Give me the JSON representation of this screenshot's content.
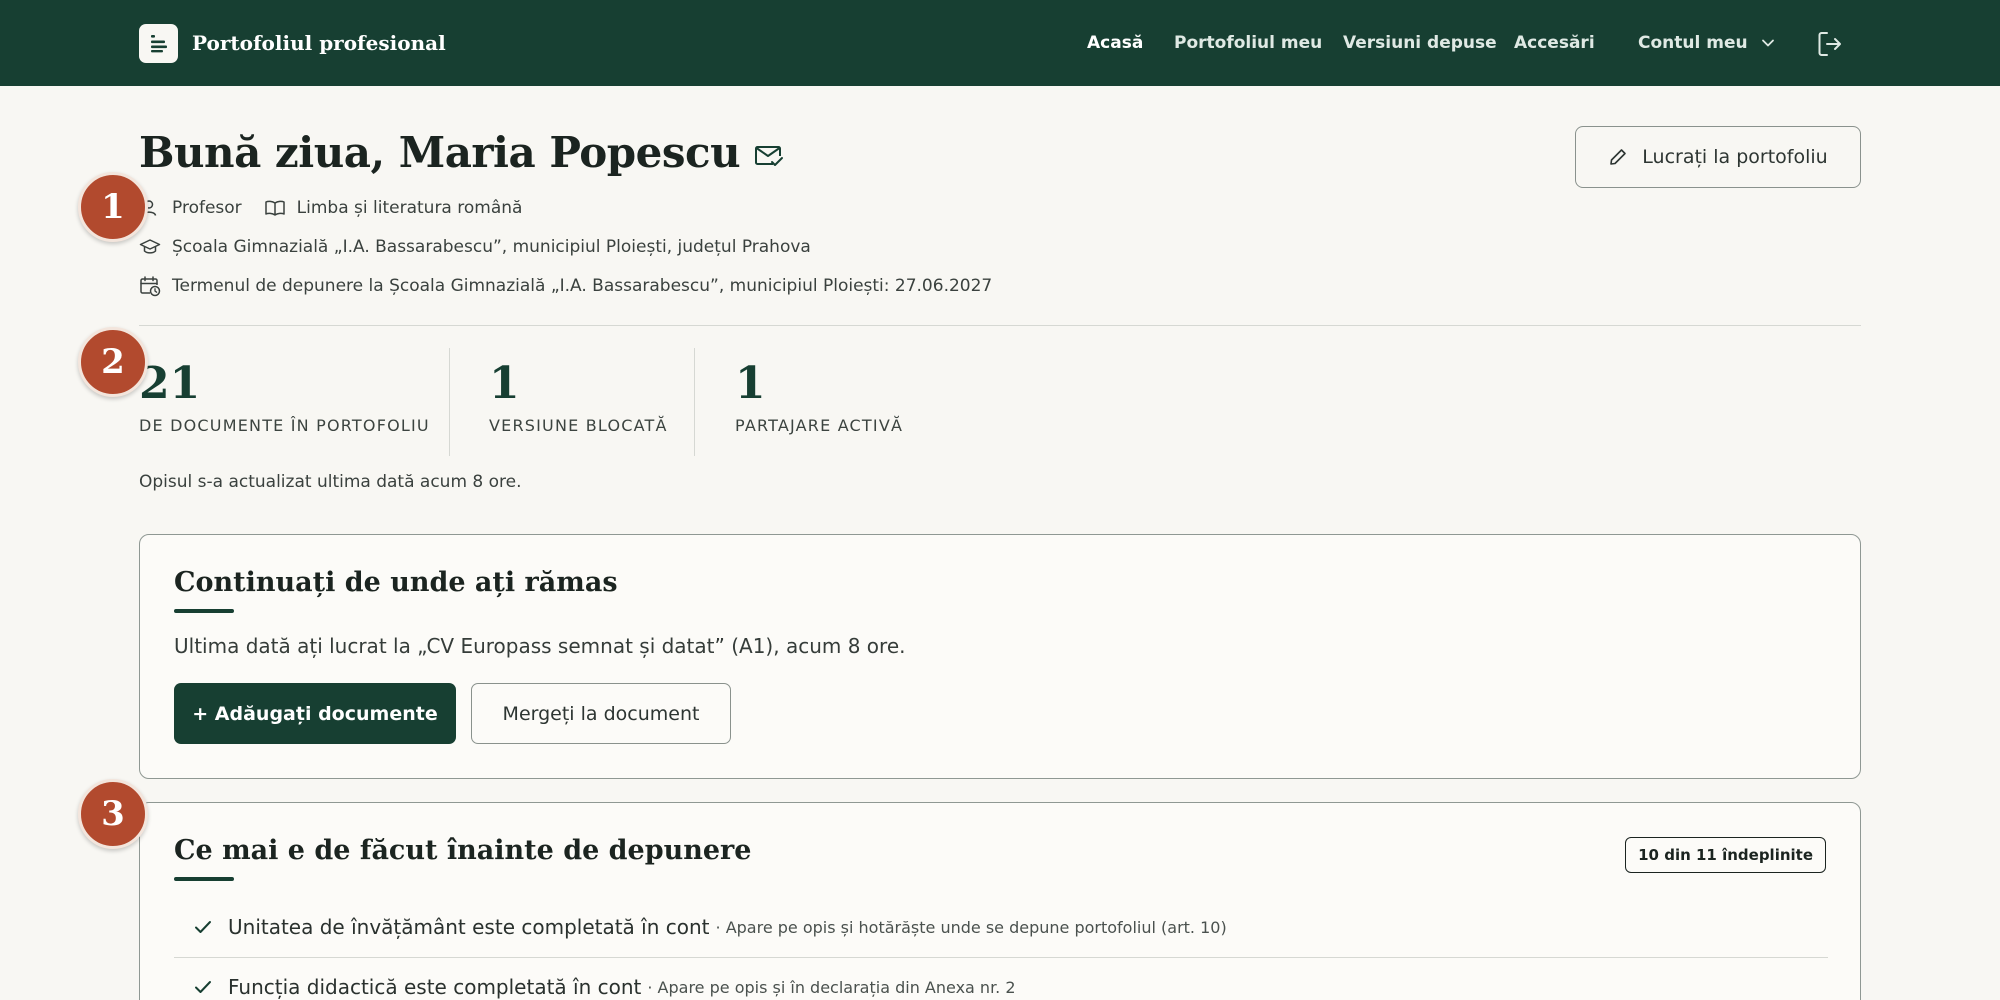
{
  "header": {
    "app_title": "Portofoliul profesional",
    "nav": [
      {
        "label": "Acasă",
        "active": true
      },
      {
        "label": "Portofoliul meu",
        "active": false
      },
      {
        "label": "Versiuni depuse",
        "active": false
      },
      {
        "label": "Accesări",
        "active": false
      }
    ],
    "account_label": "Contul meu",
    "icons": {
      "logo": "document-lines-icon",
      "account_chevron": "chevron-down-icon",
      "logout": "logout-icon"
    }
  },
  "profile": {
    "greeting": "Bună ziua, Maria Popescu",
    "role": "Profesor",
    "subject": "Limba și literatura română",
    "school": "Școala Gimnazială „I.A. Bassarabescu”, municipiul Ploiești, județul Prahova",
    "deadline": "Termenul de depunere la Școala Gimnazială „I.A. Bassarabescu”, municipiul Ploiești: 27.06.2027",
    "work_button": "Lucrați la portofoliu"
  },
  "stats": [
    {
      "value": "21",
      "label": "DE DOCUMENTE ÎN PORTOFOLIU"
    },
    {
      "value": "1",
      "label": "VERSIUNE BLOCATĂ"
    },
    {
      "value": "1",
      "label": "PARTAJARE ACTIVĂ"
    }
  ],
  "updated_note": "Opisul s-a actualizat ultima dată acum 8 ore.",
  "continue_card": {
    "title": "Continuați de unde ați rămas",
    "text": "Ultima dată ați lucrat la „CV Europass semnat și datat” (A1), acum 8 ore.",
    "primary_button": "+ Adăugați documente",
    "secondary_button": "Mergeți la document"
  },
  "todo_card": {
    "title": "Ce mai e de făcut înainte de depunere",
    "badge": "10 din 11 îndeplinite",
    "items": [
      {
        "text": "Unitatea de învățământ este completată în cont",
        "note": "· Apare pe opis și hotărăște unde se depune portofoliul (art. 10)",
        "done": true
      },
      {
        "text": "Funcția didactică este completată în cont",
        "note": "· Apare pe opis și în declarația din Anexa nr. 2",
        "done": true
      }
    ]
  },
  "markers": [
    "1",
    "2",
    "3"
  ],
  "colors": {
    "brand": "#173f32",
    "marker": "#b24a2e",
    "background": "#f8f7f3"
  }
}
